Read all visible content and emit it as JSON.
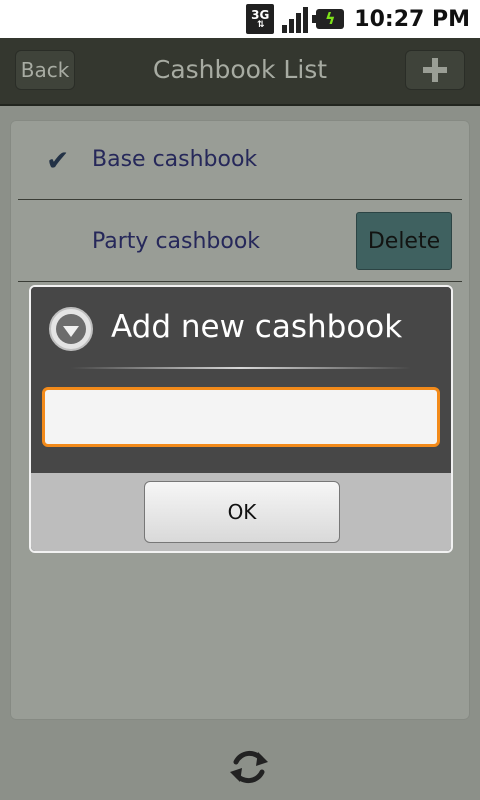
{
  "status_bar": {
    "network": "3G",
    "time": "10:27 PM"
  },
  "header": {
    "back_label": "Back",
    "title": "Cashbook List",
    "add_icon": "plus-icon"
  },
  "list": {
    "items": [
      {
        "label": "Base cashbook",
        "selected": true
      },
      {
        "label": "Party cashbook",
        "delete_label": "Delete"
      }
    ]
  },
  "dialog": {
    "title": "Add new cashbook",
    "input_value": "",
    "ok_label": "OK"
  },
  "colors": {
    "accent_orange": "#f28a1a",
    "header_bg": "#34372f",
    "delete_bg": "#3f6160"
  }
}
